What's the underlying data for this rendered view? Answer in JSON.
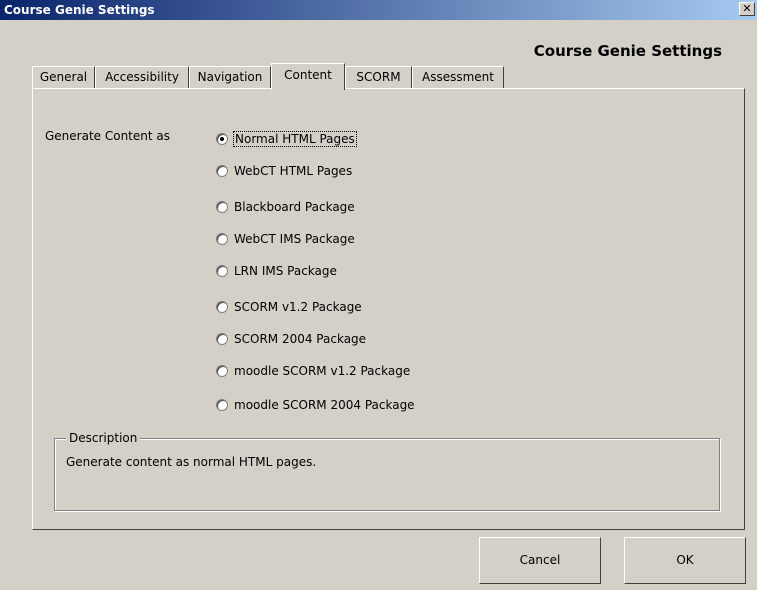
{
  "window": {
    "title": "Course Genie Settings",
    "close_glyph": "✕"
  },
  "header": {
    "title": "Course Genie Settings"
  },
  "tabs": [
    "General",
    "Accessibility",
    "Navigation",
    "Content",
    "SCORM",
    "Assessment"
  ],
  "active_tab": "Content",
  "content": {
    "generate_label": "Generate Content as",
    "options": [
      "Normal HTML Pages",
      "WebCT HTML Pages",
      "Blackboard Package",
      "WebCT IMS Package",
      "LRN IMS Package",
      "SCORM v1.2 Package",
      "SCORM 2004 Package",
      "moodle SCORM v1.2 Package",
      "moodle SCORM 2004 Package"
    ],
    "selected": "Normal HTML Pages"
  },
  "description": {
    "legend": "Description",
    "text": "Generate content as normal HTML pages."
  },
  "buttons": {
    "cancel": "Cancel",
    "ok": "OK"
  }
}
